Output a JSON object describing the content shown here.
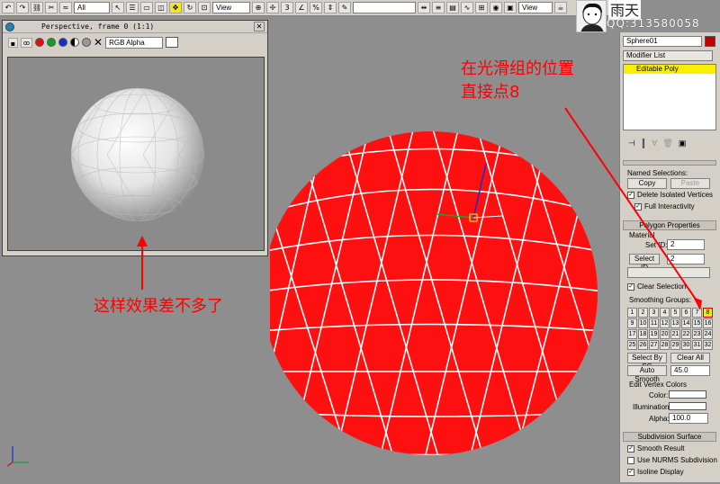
{
  "toolbar": {
    "filter_value": "All",
    "ref_coord": "View",
    "named_sel": "",
    "view_label": "View"
  },
  "user": {
    "name": "雨天",
    "qq": "QQ:313580058"
  },
  "render_window": {
    "title": "Perspective, frame 0 (1:1)",
    "channel": "RGB Alpha"
  },
  "command_panel": {
    "object_name": "Sphere01",
    "modifier_list": "Modifier List",
    "stack_item": "Editable Poly",
    "named_selections": "Named Selections:",
    "copy": "Copy",
    "paste": "Paste",
    "delete_isolated": "Delete Isolated Vertices",
    "full_interactivity": "Full Interactivity",
    "polygon_properties": "Polygon Properties",
    "material": "Material",
    "set_id": "Set ID:",
    "set_id_value": "2",
    "select_id": "Select ID",
    "select_id_value": "2",
    "clear_selection": "Clear Selection",
    "smoothing_groups": "Smoothing Groups:",
    "sg_numbers": [
      "1",
      "2",
      "3",
      "4",
      "5",
      "6",
      "7",
      "8",
      "9",
      "10",
      "11",
      "12",
      "13",
      "14",
      "15",
      "16",
      "17",
      "18",
      "19",
      "20",
      "21",
      "22",
      "23",
      "24",
      "25",
      "26",
      "27",
      "28",
      "29",
      "30",
      "31",
      "32"
    ],
    "select_by_sg": "Select By SG",
    "clear_all": "Clear All",
    "auto_smooth": "Auto Smooth",
    "auto_smooth_value": "45.0",
    "edit_vertex_colors": "Edit Vertex Colors",
    "color": "Color:",
    "illumination": "Illumination:",
    "alpha": "Alpha:",
    "alpha_value": "100.0",
    "subdivision_surface": "Subdivision Surface",
    "smooth_result": "Smooth Result",
    "use_nurms": "Use NURMS Subdivision",
    "isoline_display": "Isoline Display"
  },
  "annotations": {
    "top_right": "在光滑组的位置\n直接点8",
    "left": "这样效果差不多了"
  },
  "colors": {
    "sphere_red": "#ff1010",
    "highlight": "#f4e71a",
    "annotation": "#ff0000"
  }
}
